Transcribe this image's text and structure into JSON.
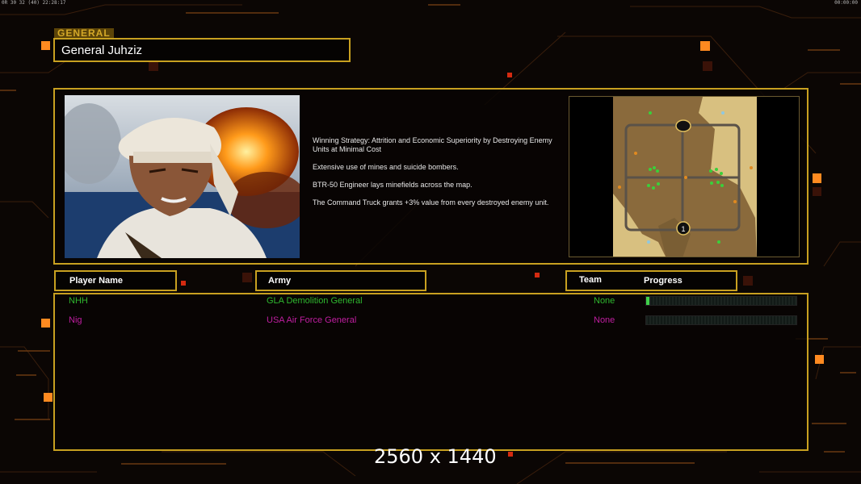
{
  "hud": {
    "debug_left": "0R 30 32 (40) 22:28:17",
    "debug_right": "00:00:00"
  },
  "general": {
    "tag": "GENERAL",
    "name": "General Juhziz"
  },
  "strategy": {
    "lines": [
      "Winning Strategy: Attrition and Economic Superiority by Destroying Enemy Units at Minimal Cost",
      "Extensive use of mines and suicide bombers.",
      "BTR-50 Engineer lays minefields across the map.",
      "The Command Truck grants +3% value from every destroyed enemy unit."
    ]
  },
  "map": {
    "player_marker": "1"
  },
  "headers": {
    "player_name": "Player Name",
    "army": "Army",
    "team": "Team",
    "progress": "Progress"
  },
  "players": [
    {
      "name": "NHH",
      "army": "GLA Demolition General",
      "team": "None",
      "color": "#2fb82f",
      "progress": 0.02
    },
    {
      "name": "Nig",
      "army": "USA Air Force General",
      "team": "None",
      "color": "#c01ea0",
      "progress": 0.0
    }
  ],
  "footer": {
    "resolution": "2560 x 1440"
  },
  "colors": {
    "accent": "#c8a020",
    "orange_light": "#ff8a20"
  }
}
